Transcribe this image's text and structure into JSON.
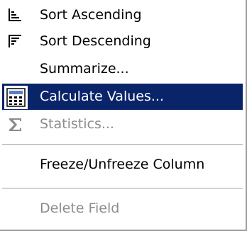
{
  "menu": {
    "items": [
      {
        "label": "Sort Ascending",
        "icon": "sort-ascending-icon",
        "enabled": true,
        "selected": false
      },
      {
        "label": "Sort Descending",
        "icon": "sort-descending-icon",
        "enabled": true,
        "selected": false
      },
      {
        "label": "Summarize...",
        "icon": "",
        "enabled": true,
        "selected": false
      },
      {
        "label": "Calculate Values...",
        "icon": "calculator-icon",
        "enabled": true,
        "selected": true
      },
      {
        "label": "Statistics...",
        "icon": "sigma-icon",
        "enabled": false,
        "selected": false
      },
      {
        "label": "Freeze/Unfreeze Column",
        "icon": "",
        "enabled": true,
        "selected": false
      },
      {
        "label": "Delete Field",
        "icon": "",
        "enabled": false,
        "selected": false
      }
    ]
  },
  "colors": {
    "highlight": "#0a246a",
    "highlight_text": "#ffffff",
    "disabled_text": "#8c8c8c"
  }
}
